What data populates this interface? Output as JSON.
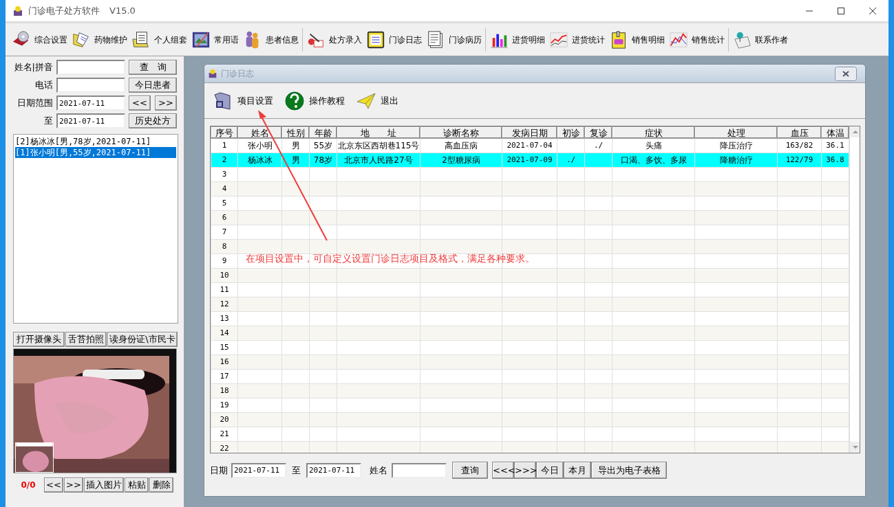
{
  "window": {
    "title": "门诊电子处方软件",
    "version": "V15.0"
  },
  "toolbar": [
    {
      "label": "综合设置"
    },
    {
      "label": "药物维护"
    },
    {
      "label": "个人组套"
    },
    {
      "label": "常用语"
    },
    {
      "label": "患者信息"
    },
    {
      "label": "处方录入"
    },
    {
      "label": "门诊日志"
    },
    {
      "label": "门诊病历"
    },
    {
      "label": "进货明细"
    },
    {
      "label": "进货统计"
    },
    {
      "label": "销售明细"
    },
    {
      "label": "销售统计"
    },
    {
      "label": "联系作者"
    }
  ],
  "search_form": {
    "name_label": "姓名|拼音",
    "phone_label": "电话",
    "date_label": "日期范围",
    "date_from": "2021-07-11",
    "to_label": "至",
    "date_to": "2021-07-11",
    "query_button": "查　询",
    "today_button": "今日患者",
    "prev_button": "<<",
    "next_button": ">>",
    "history_button": "历史处方"
  },
  "patient_list": [
    {
      "text": "[2]杨冰冰[男,78岁,2021-07-11]",
      "selected": false
    },
    {
      "text": "[1]张小明[男,55岁,2021-07-11]",
      "selected": true
    }
  ],
  "camera_buttons": [
    "打开摄像头",
    "舌苔拍照",
    "读身份证\\市民卡"
  ],
  "photo_counter": "0/0",
  "photo_buttons": [
    "<<",
    ">>",
    "插入图片",
    "粘贴",
    "删除"
  ],
  "log_window": {
    "title": "门诊日志",
    "actions": [
      {
        "label": "项目设置"
      },
      {
        "label": "操作教程"
      },
      {
        "label": "退出"
      }
    ],
    "table": {
      "columns": [
        "序号",
        "姓名",
        "性别",
        "年龄",
        "地　　址",
        "诊断名称",
        "发病日期",
        "初诊",
        "复诊",
        "症状",
        "处理",
        "血压",
        "体温"
      ],
      "rows": [
        {
          "no": "1",
          "name": "张小明",
          "sex": "男",
          "age": "55岁",
          "address": "北京东区西胡巷115号",
          "diagnosis": "高血压病",
          "onset": "2021-07-04",
          "revisit": "./",
          "symptom": "头痛",
          "treatment": "降压治疗",
          "bp": "163/82",
          "temp": "36.1",
          "selected": false
        },
        {
          "no": "2",
          "name": "杨冰冰",
          "sex": "男",
          "age": "78岁",
          "address": "北京市人民路27号",
          "diagnosis": "2型糖尿病",
          "onset": "2021-07-09",
          "first": "./",
          "symptom": "口渴、多饮、多尿",
          "treatment": "降糖治疗",
          "bp": "122/79",
          "temp": "36.8",
          "selected": true
        },
        {
          "no": "3",
          "selected": false
        },
        {
          "no": "4",
          "selected": false
        },
        {
          "no": "5",
          "selected": false
        },
        {
          "no": "6",
          "selected": false
        },
        {
          "no": "7",
          "selected": false
        },
        {
          "no": "8",
          "selected": false
        },
        {
          "no": "9",
          "selected": false
        },
        {
          "no": "10",
          "selected": false
        },
        {
          "no": "11",
          "selected": false
        },
        {
          "no": "12",
          "selected": false
        },
        {
          "no": "13",
          "selected": false
        },
        {
          "no": "14",
          "selected": false
        },
        {
          "no": "15",
          "selected": false
        },
        {
          "no": "16",
          "selected": false
        },
        {
          "no": "17",
          "selected": false
        },
        {
          "no": "18",
          "selected": false
        },
        {
          "no": "19",
          "selected": false
        },
        {
          "no": "20",
          "selected": false
        },
        {
          "no": "21",
          "selected": false
        },
        {
          "no": "22",
          "selected": false
        }
      ]
    },
    "annotation": "在项目设置中，可自定义设置门诊日志项目及格式，满足各种要求。",
    "filter": {
      "date_label": "日期",
      "date_from": "2021-07-11",
      "to_label": "至",
      "date_to": "2021-07-11",
      "name_label": "姓名",
      "buttons": [
        "查询",
        "<<<",
        ">>>",
        "今日",
        "本月",
        "导出为电子表格"
      ]
    }
  }
}
